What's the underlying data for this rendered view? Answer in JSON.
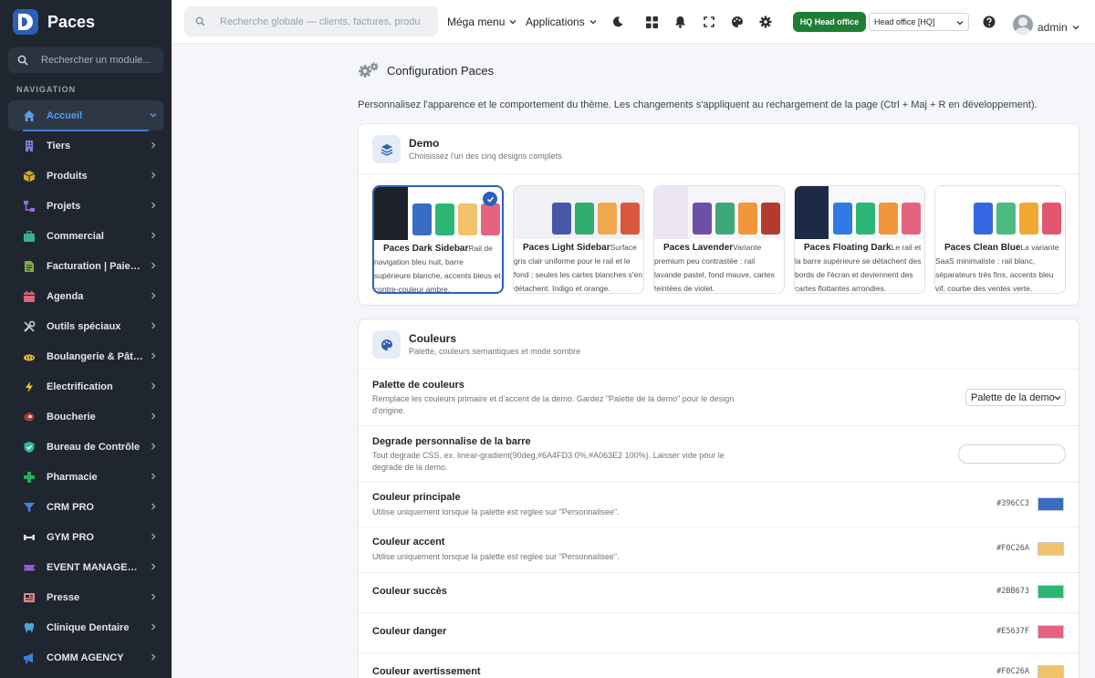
{
  "brand": {
    "name": "Paces"
  },
  "sidebar": {
    "search_placeholder": "Rechercher un module...",
    "heading": "NAVIGATION",
    "items": [
      {
        "label": "Accueil",
        "icon": "home-icon",
        "color": "#5b9bf0",
        "active": true
      },
      {
        "label": "Tiers",
        "icon": "building-icon",
        "color": "#7c83d6"
      },
      {
        "label": "Produits",
        "icon": "box-icon",
        "color": "#d4a72c"
      },
      {
        "label": "Projets",
        "icon": "sitemap-icon",
        "color": "#9b6bd6"
      },
      {
        "label": "Commercial",
        "icon": "briefcase-icon",
        "color": "#3bb18a"
      },
      {
        "label": "Facturation | Paiement",
        "icon": "invoice-icon",
        "color": "#7fae3e"
      },
      {
        "label": "Agenda",
        "icon": "calendar-icon",
        "color": "#d9667a"
      },
      {
        "label": "Outils spéciaux",
        "icon": "tools-icon",
        "color": "#c5cbd3"
      },
      {
        "label": "Boulangerie & Pâtisserie",
        "icon": "bread-icon",
        "color": "#e8b93a"
      },
      {
        "label": "Electrification",
        "icon": "bolt-icon",
        "color": "#f1c40f"
      },
      {
        "label": "Boucherie",
        "icon": "meat-icon",
        "color": "#b03a2e"
      },
      {
        "label": "Bureau de Contrôle",
        "icon": "shield-check-icon",
        "color": "#2fb3a5"
      },
      {
        "label": "Pharmacie",
        "icon": "cross-icon",
        "color": "#27ae60"
      },
      {
        "label": "CRM PRO",
        "icon": "funnel-icon",
        "color": "#4a7fe0"
      },
      {
        "label": "GYM PRO",
        "icon": "dumbbell-icon",
        "color": "#dfe3e8"
      },
      {
        "label": "EVENT MANAGEMENT",
        "icon": "ticket-icon",
        "color": "#8e5cd6"
      },
      {
        "label": "Presse",
        "icon": "newspaper-icon",
        "color": "#d98a8a"
      },
      {
        "label": "Clinique Dentaire",
        "icon": "tooth-icon",
        "color": "#4aa8d8"
      },
      {
        "label": "COMM AGENCY",
        "icon": "megaphone-icon",
        "color": "#3d7be0"
      }
    ]
  },
  "topbar": {
    "search_placeholder": "Recherche globale — clients, factures, produits...",
    "mega_menu": "Méga menu",
    "applications": "Applications",
    "hq_badge": "HQ  Head office",
    "office": "Head office [HQ]",
    "user": "admin"
  },
  "page": {
    "title": "Configuration Paces",
    "description": "Personnalisez l'apparence et le comportement du thème. Les changements s'appliquent au rechargement de la page (Ctrl + Maj + R en développement)."
  },
  "demo_card": {
    "title": "Demo",
    "subtitle": "Choisissez l'un des cinq designs complets",
    "demos": [
      {
        "name": "Paces Dark Sidebar",
        "desc": "Rail de navigation bleu nuit, barre supérieure blanche, accents bleus et contre-couleur ambre.",
        "rail": "#1d2129",
        "bg": "#ffffff",
        "swatches": [
          "#396cc3",
          "#2bb673",
          "#f0c26a",
          "#e5637f"
        ],
        "selected": true
      },
      {
        "name": "Paces Light Sidebar",
        "desc": "Surface gris clair uniforme pour le rail et le fond ; seules les cartes blanches s'en détachent. Indigo et orange.",
        "rail": "#f0f1f4",
        "bg": "#f0f1f4",
        "swatches": [
          "#4758a8",
          "#2fae70",
          "#f0a84f",
          "#d9573f"
        ],
        "selected": false
      },
      {
        "name": "Paces Lavender",
        "desc": "Variante premium peu contrastée : rail lavande pastel, fond mauve, cartes teintées de violet.",
        "rail": "#ece6f2",
        "bg": "#f7f5f9",
        "swatches": [
          "#6e4fa8",
          "#3aa878",
          "#f0963b",
          "#b33b2e"
        ],
        "selected": false
      },
      {
        "name": "Paces Floating Dark",
        "desc": "Le rail et la barre supérieure se détachent des bords de l'écran et deviennent des cartes flottantes arrondies.",
        "rail": "#1e2a44",
        "bg": "#f7f8fa",
        "swatches": [
          "#2f7ae5",
          "#2bb673",
          "#f0963b",
          "#e5637f"
        ],
        "selected": false
      },
      {
        "name": "Paces Clean Blue",
        "desc": "La variante SaaS minimaliste : rail blanc, séparateurs très fins, accents bleu vif, courbe des ventes verte.",
        "rail": "#ffffff",
        "bg": "#ffffff",
        "swatches": [
          "#3567e3",
          "#4cbb7f",
          "#f0a830",
          "#e2566f"
        ],
        "selected": false
      }
    ]
  },
  "colors_card": {
    "title": "Couleurs",
    "subtitle": "Palette, couleurs semantiques et mode sombre",
    "palette": {
      "label": "Palette de couleurs",
      "desc": "Remplace les couleurs primaire et d'accent de la demo. Gardez \"Palette de la demo\" pour le design d'origine.",
      "value": "Palette de la demo"
    },
    "gradient": {
      "label": "Degrade personnalise de la barre",
      "desc": "Tout degrade CSS, ex. linear-gradient(90deg,#6A4FD3 0%,#A063E2 100%). Laisser vide pour le degrade de la demo.",
      "value": ""
    },
    "colors": [
      {
        "label": "Couleur principale",
        "desc": "Utilise uniquement lorsque la palette est reglee sur \"Personnalisee\".",
        "hex": "#396CC3"
      },
      {
        "label": "Couleur accent",
        "desc": "Utilise uniquement lorsque la palette est reglee sur \"Personnalisee\".",
        "hex": "#F0C26A"
      },
      {
        "label": "Couleur succès",
        "desc": "",
        "hex": "#2BB673"
      },
      {
        "label": "Couleur danger",
        "desc": "",
        "hex": "#E5637F"
      },
      {
        "label": "Couleur avertissement",
        "desc": "",
        "hex": "#F0C26A"
      }
    ]
  }
}
